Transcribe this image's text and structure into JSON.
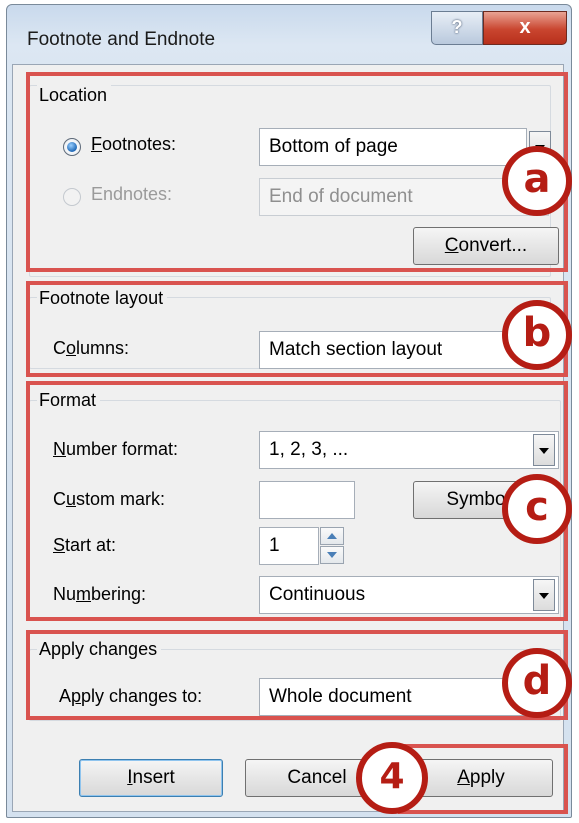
{
  "window": {
    "title": "Footnote and Endnote",
    "help_label": "?",
    "close_label": "x"
  },
  "location": {
    "legend": "Location",
    "footnotes": {
      "label_u": "F",
      "label_rest": "ootnotes:",
      "value": "Bottom of page",
      "selected": true
    },
    "endnotes": {
      "label": "Endnotes:",
      "value": "End of document",
      "selected": false,
      "enabled": false
    },
    "convert_button": {
      "label_u": "C",
      "label_rest": "onvert..."
    }
  },
  "footnote_layout": {
    "legend": "Footnote layout",
    "columns": {
      "label_pre": "C",
      "label_u": "o",
      "label_rest": "lumns:",
      "value": "Match section layout"
    }
  },
  "format": {
    "legend": "Format",
    "number_format": {
      "label_u": "N",
      "label_rest": "umber format:",
      "value": "1, 2, 3, ..."
    },
    "custom_mark": {
      "label_pre": "C",
      "label_u": "u",
      "label_rest": "stom mark:",
      "value": ""
    },
    "symbol_button": {
      "label": "Symbol..."
    },
    "start_at": {
      "label_u": "S",
      "label_rest": "tart at:",
      "value": "1"
    },
    "numbering": {
      "label_pre": "Nu",
      "label_u": "m",
      "label_rest": "bering:",
      "value": "Continuous"
    }
  },
  "apply_changes": {
    "legend": "Apply changes",
    "apply_to": {
      "label_pre": "A",
      "label_u": "p",
      "label_rest": "ply changes to:",
      "value": "Whole document"
    }
  },
  "buttons": {
    "insert": {
      "label_u": "I",
      "label_rest": "nsert"
    },
    "cancel": {
      "label": "Cancel"
    },
    "apply": {
      "label_u": "A",
      "label_rest": "pply"
    }
  },
  "annotations": {
    "a": "a",
    "b": "b",
    "c": "c",
    "d": "d",
    "step": "4"
  },
  "colors": {
    "annotation_red": "#d9534f",
    "badge_red": "#b51d14"
  }
}
